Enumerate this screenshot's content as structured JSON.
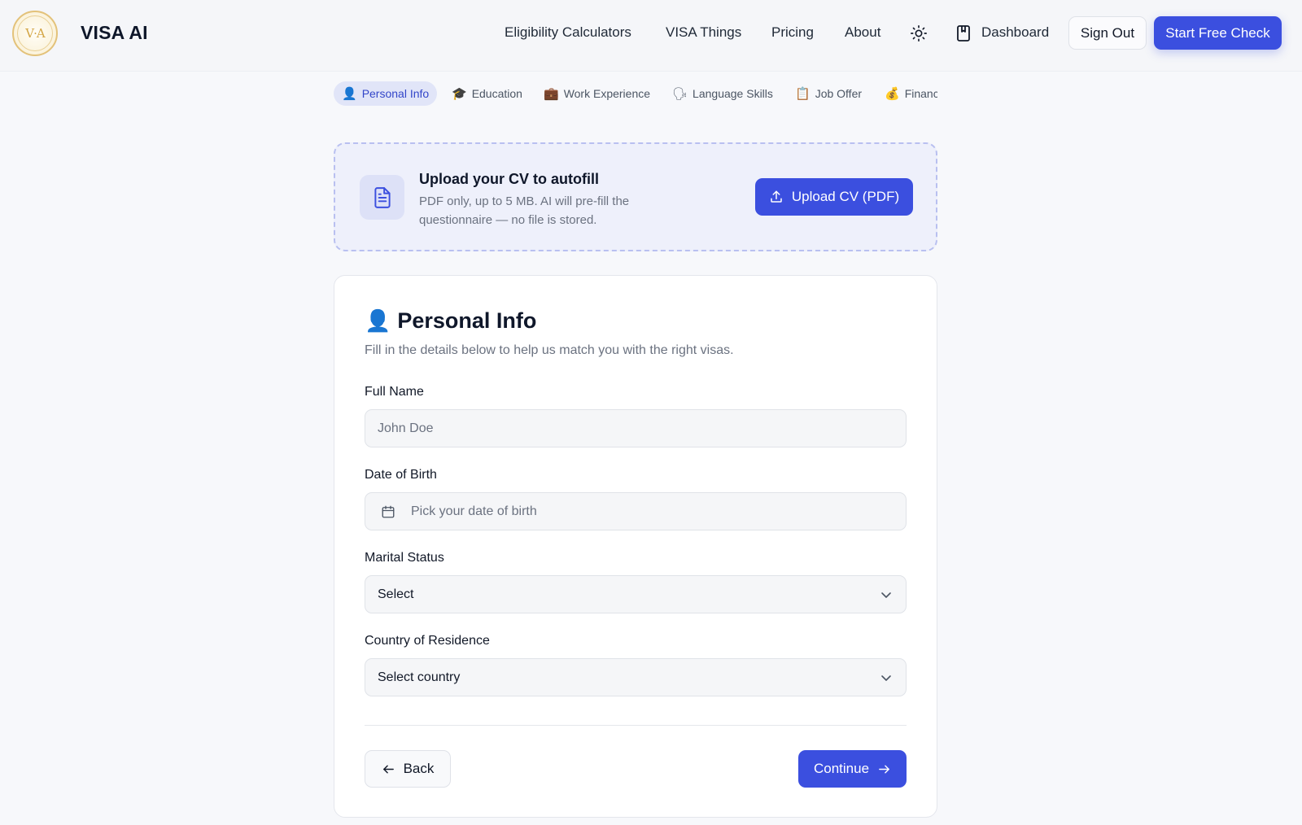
{
  "header": {
    "logo_text": "V·A",
    "brand": "VISA AI",
    "nav": [
      {
        "label": "Eligibility Calculators"
      },
      {
        "label": "VISA Things"
      },
      {
        "label": "Pricing"
      },
      {
        "label": "About"
      }
    ],
    "theme_icon": "sun-icon",
    "dashboard_icon": "bookmark-icon",
    "dashboard_label": "Dashboard",
    "signout_label": "Sign Out",
    "start_label": "Start Free Check",
    "accent_color": "#3b4fdf"
  },
  "steps": [
    {
      "emoji": "👤",
      "label": "Personal Info",
      "active": true
    },
    {
      "emoji": "🎓",
      "label": "Education"
    },
    {
      "emoji": "💼",
      "label": "Work Experience"
    },
    {
      "emoji": "🗣",
      "label": "Language Skills"
    },
    {
      "emoji": "📋",
      "label": "Job Offer"
    },
    {
      "emoji": "💰",
      "label": "Financ"
    }
  ],
  "upload": {
    "icon": "document-icon",
    "title": "Upload your CV to autofill",
    "description": "PDF only, up to 5 MB. AI will pre-fill the questionnaire — no file is stored.",
    "button_icon": "upload-icon",
    "button_label": "Upload CV (PDF)"
  },
  "form": {
    "emoji": "👤",
    "title": "Personal Info",
    "subtitle": "Fill in the details below to help us match you with the right visas.",
    "full_name": {
      "label": "Full Name",
      "placeholder": "John Doe",
      "value": ""
    },
    "dob": {
      "label": "Date of Birth",
      "placeholder": "Pick your date of birth",
      "icon": "calendar-icon"
    },
    "marital": {
      "label": "Marital Status",
      "selected": "Select"
    },
    "country": {
      "label": "Country of Residence",
      "selected": "Select country"
    },
    "back_label": "Back",
    "continue_label": "Continue"
  }
}
